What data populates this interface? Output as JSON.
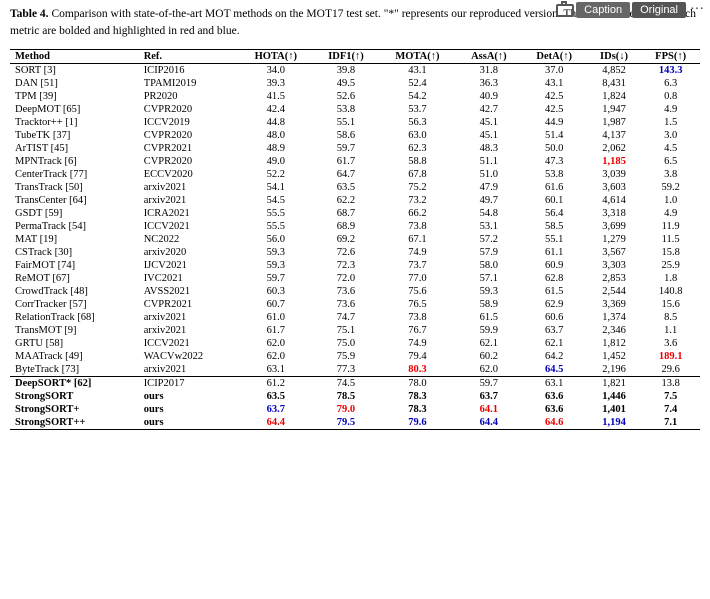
{
  "topbar": {
    "caption_label": "Caption",
    "original_label": "Original",
    "dots": "···"
  },
  "caption": {
    "prefix": "Table 4.",
    "text": " Comparison with state-of-the-art MOT methods on the MOT17 test set. \"*\" represents our reproduced version. The two best results for each metric are bolded and highlighted in red and blue."
  },
  "table": {
    "headers": [
      "Method",
      "Ref.",
      "HOTA(↑)",
      "IDF1(↑)",
      "MOTA(↑)",
      "AssA(↑)",
      "DetA(↑)",
      "IDs(↓)",
      "FPS(↑)"
    ],
    "rows": [
      [
        "SORT [3]",
        "ICIP2016",
        "34.0",
        "39.8",
        "43.1",
        "31.8",
        "37.0",
        "4,852",
        "143.3"
      ],
      [
        "DAN [51]",
        "TPAMI2019",
        "39.3",
        "49.5",
        "52.4",
        "36.3",
        "43.1",
        "8,431",
        "6.3"
      ],
      [
        "TPM [39]",
        "PR2020",
        "41.5",
        "52.6",
        "54.2",
        "40.9",
        "42.5",
        "1,824",
        "0.8"
      ],
      [
        "DeepMOT [65]",
        "CVPR2020",
        "42.4",
        "53.8",
        "53.7",
        "42.7",
        "42.5",
        "1,947",
        "4.9"
      ],
      [
        "Tracktor++ [1]",
        "ICCV2019",
        "44.8",
        "55.1",
        "56.3",
        "45.1",
        "44.9",
        "1,987",
        "1.5"
      ],
      [
        "TubeTK [37]",
        "CVPR2020",
        "48.0",
        "58.6",
        "63.0",
        "45.1",
        "51.4",
        "4,137",
        "3.0"
      ],
      [
        "ArTIST [45]",
        "CVPR2021",
        "48.9",
        "59.7",
        "62.3",
        "48.3",
        "50.0",
        "2,062",
        "4.5"
      ],
      [
        "MPNTrack [6]",
        "CVPR2020",
        "49.0",
        "61.7",
        "58.8",
        "51.1",
        "47.3",
        "1,185",
        "6.5"
      ],
      [
        "CenterTrack [77]",
        "ECCV2020",
        "52.2",
        "64.7",
        "67.8",
        "51.0",
        "53.8",
        "3,039",
        "3.8"
      ],
      [
        "TransTrack [50]",
        "arxiv2021",
        "54.1",
        "63.5",
        "75.2",
        "47.9",
        "61.6",
        "3,603",
        "59.2"
      ],
      [
        "TransCenter [64]",
        "arxiv2021",
        "54.5",
        "62.2",
        "73.2",
        "49.7",
        "60.1",
        "4,614",
        "1.0"
      ],
      [
        "GSDT [59]",
        "ICRA2021",
        "55.5",
        "68.7",
        "66.2",
        "54.8",
        "56.4",
        "3,318",
        "4.9"
      ],
      [
        "PermaTrack [54]",
        "ICCV2021",
        "55.5",
        "68.9",
        "73.8",
        "53.1",
        "58.5",
        "3,699",
        "11.9"
      ],
      [
        "MAT [19]",
        "NC2022",
        "56.0",
        "69.2",
        "67.1",
        "57.2",
        "55.1",
        "1,279",
        "11.5"
      ],
      [
        "CSTrack [30]",
        "arxiv2020",
        "59.3",
        "72.6",
        "74.9",
        "57.9",
        "61.1",
        "3,567",
        "15.8"
      ],
      [
        "FairMOT [74]",
        "IJCV2021",
        "59.3",
        "72.3",
        "73.7",
        "58.0",
        "60.9",
        "3,303",
        "25.9"
      ],
      [
        "ReMOT [67]",
        "IVC2021",
        "59.7",
        "72.0",
        "77.0",
        "57.1",
        "62.8",
        "2,853",
        "1.8"
      ],
      [
        "CrowdTrack [48]",
        "AVSS2021",
        "60.3",
        "73.6",
        "75.6",
        "59.3",
        "61.5",
        "2,544",
        "140.8"
      ],
      [
        "CorrTracker [57]",
        "CVPR2021",
        "60.7",
        "73.6",
        "76.5",
        "58.9",
        "62.9",
        "3,369",
        "15.6"
      ],
      [
        "RelationTrack [68]",
        "arxiv2021",
        "61.0",
        "74.7",
        "73.8",
        "61.5",
        "60.6",
        "1,374",
        "8.5"
      ],
      [
        "TransMOT [9]",
        "arxiv2021",
        "61.7",
        "75.1",
        "76.7",
        "59.9",
        "63.7",
        "2,346",
        "1.1"
      ],
      [
        "GRTU [58]",
        "ICCV2021",
        "62.0",
        "75.0",
        "74.9",
        "62.1",
        "62.1",
        "1,812",
        "3.6"
      ],
      [
        "MAATrack [49]",
        "WACVw2022",
        "62.0",
        "75.9",
        "79.4",
        "60.2",
        "64.2",
        "1,452",
        "189.1"
      ],
      [
        "ByteTrack [73]",
        "arxiv2021",
        "63.1",
        "77.3",
        "80.3",
        "62.0",
        "64.5",
        "2,196",
        "29.6"
      ]
    ],
    "bold_rows": [
      [
        "DeepSORT* [62]",
        "ICIP2017",
        "61.2",
        "74.5",
        "78.0",
        "59.7",
        "63.1",
        "1,821",
        "13.8"
      ],
      [
        "StrongSORT",
        "ours",
        "63.5",
        "78.5",
        "78.3",
        "63.7",
        "63.6",
        "1,446",
        "7.5"
      ],
      [
        "StrongSORT+",
        "ours",
        "63.7",
        "79.0",
        "78.3",
        "64.1",
        "63.6",
        "1,401",
        "7.4"
      ],
      [
        "StrongSORT++",
        "ours",
        "64.4",
        "79.5",
        "79.6",
        "64.4",
        "64.6",
        "1,194",
        "7.1"
      ]
    ],
    "special_cells": {
      "sort_fps": {
        "row": 0,
        "col": 8,
        "class": "blue bold"
      },
      "mpn_ids": {
        "row": 7,
        "col": 7,
        "class": "red bold"
      },
      "maatrack_fps": {
        "row": 22,
        "col": 8,
        "class": "red bold"
      },
      "bytetrack_mota": {
        "row": 23,
        "col": 4,
        "class": "red bold"
      },
      "bytetrack_deta": {
        "row": 23,
        "col": 6,
        "class": "blue bold"
      },
      "strongsort_plus_hota": {
        "brow": 2,
        "col": 2,
        "class": "blue bold"
      },
      "strongsort_plus_idf1": {
        "brow": 2,
        "col": 3,
        "class": "red bold"
      },
      "strongsort_plus_assa": {
        "brow": 2,
        "col": 5,
        "class": "red bold"
      },
      "strongsortpp_hota": {
        "brow": 3,
        "col": 2,
        "class": "red bold"
      },
      "strongsortpp_idf1": {
        "brow": 3,
        "col": 3,
        "class": "blue bold"
      },
      "strongsortpp_mota": {
        "brow": 3,
        "col": 4,
        "class": "blue bold"
      },
      "strongsortpp_assa": {
        "brow": 3,
        "col": 5,
        "class": "blue bold"
      },
      "strongsortpp_deta": {
        "brow": 3,
        "col": 6,
        "class": "red bold"
      },
      "strongsortpp_ids": {
        "brow": 3,
        "col": 7,
        "class": "blue bold"
      }
    }
  }
}
